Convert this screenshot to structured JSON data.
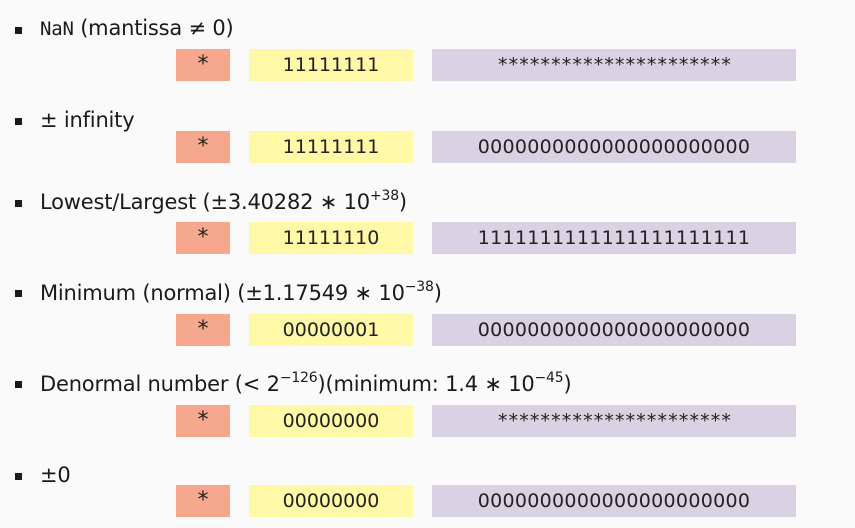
{
  "colors": {
    "sign": "#f6a88f",
    "exponent": "#fff8a6",
    "mantissa": "#d8d2e2"
  },
  "items": [
    {
      "label_main": "NaN",
      "label_rest": " (mantissa ≠ 0)",
      "sign": "*",
      "exponent": "11111111",
      "mantissa": "**********************"
    },
    {
      "label_rest": "± infinity",
      "sign": "*",
      "exponent": "11111111",
      "mantissa": "0000000000000000000000"
    },
    {
      "label_rest": "Lowest/Largest (±3.40282 ∗ 10",
      "label_sup": "+38",
      "label_tail": ")",
      "sign": "*",
      "exponent": "11111110",
      "mantissa": "1111111111111111111111"
    },
    {
      "label_rest": "Minimum (normal) (±1.17549 ∗ 10",
      "label_sup": "−38",
      "label_tail": ")",
      "sign": "*",
      "exponent": "00000001",
      "mantissa": "0000000000000000000000"
    },
    {
      "label_rest": "Denormal number (< 2",
      "label_sup": "−126",
      "label_tail": ")(minimum: 1.4 ∗ 10",
      "label_sup2": "−45",
      "label_tail2": ")",
      "sign": "*",
      "exponent": "00000000",
      "mantissa": "**********************"
    },
    {
      "label_rest": "±0",
      "sign": "*",
      "exponent": "00000000",
      "mantissa": "0000000000000000000000"
    }
  ]
}
